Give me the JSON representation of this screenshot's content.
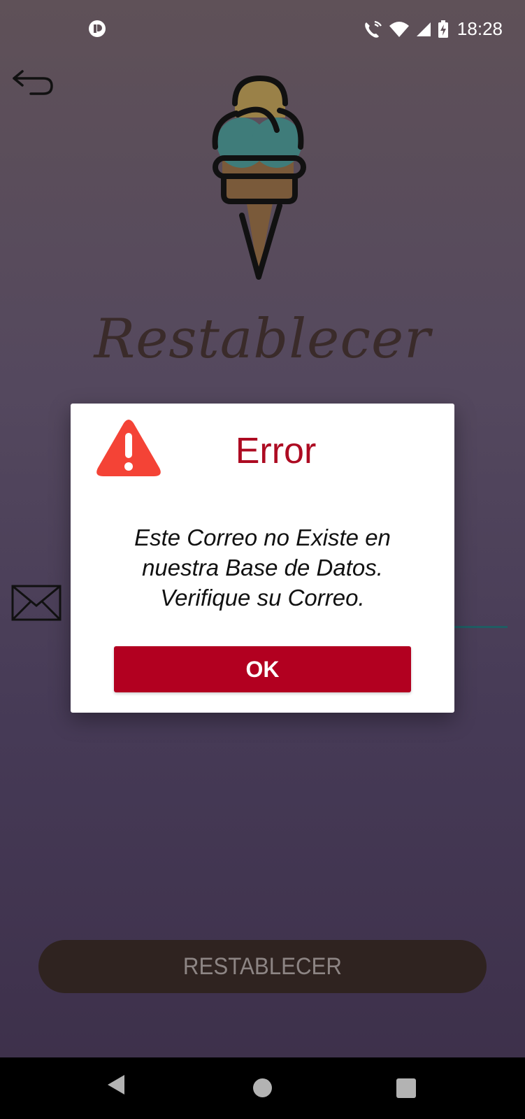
{
  "status_bar": {
    "time": "18:28",
    "icons": [
      "notification-app-icon",
      "wifi-calling-icon",
      "wifi-icon",
      "signal-icon",
      "battery-charging-icon"
    ]
  },
  "header": {
    "back_icon": "back-arrow-icon",
    "logo_icon": "ice-cream-cone-icon"
  },
  "screen": {
    "title": "Restablecer",
    "email_icon": "envelope-icon",
    "submit_label": "RESTABLECER"
  },
  "dialog": {
    "icon": "warning-icon",
    "title": "Error",
    "message_lines": [
      "Este Correo no Existe en",
      "nuestra Base de Datos.",
      "Verifique su Correo."
    ],
    "ok_label": "OK"
  },
  "nav_bar": {
    "icons": [
      "nav-back-icon",
      "nav-home-icon",
      "nav-recents-icon"
    ]
  },
  "colors": {
    "accent": "#b20020",
    "dialog_title": "#ad0b22",
    "background_top": "#5f5158",
    "background_bottom": "#3c2f49",
    "button_dark": "#2f2320"
  }
}
